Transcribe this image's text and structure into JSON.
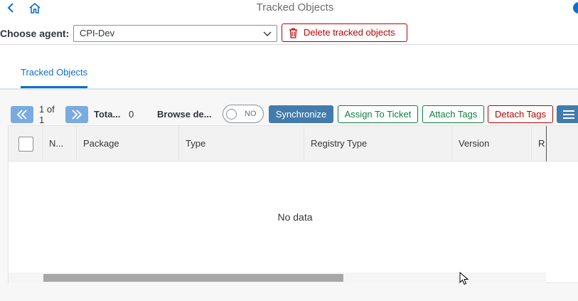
{
  "shell": {
    "title": "Tracked Objects"
  },
  "agent": {
    "label": "Choose agent:",
    "selected": "CPI-Dev",
    "delete_label": "Delete tracked objects"
  },
  "tabs": [
    {
      "label": "Tracked Objects",
      "active": true
    }
  ],
  "toolbar": {
    "pager_text": "1 of 1",
    "total_label": "Tota...",
    "total_value": "0",
    "browse_label": "Browse de...",
    "toggle_label": "NO",
    "synchronize_label": "Synchronize",
    "assign_label": "Assign To Ticket",
    "attach_label": "Attach Tags",
    "detach_label": "Detach Tags"
  },
  "table": {
    "columns": [
      "N...",
      "Package",
      "Type",
      "Registry Type",
      "Version",
      "R"
    ],
    "empty_text": "No data"
  },
  "colors": {
    "accent": "#0a6ed1",
    "button_blue": "#427cac",
    "positive": "#107e3e",
    "negative": "#bb0000"
  }
}
